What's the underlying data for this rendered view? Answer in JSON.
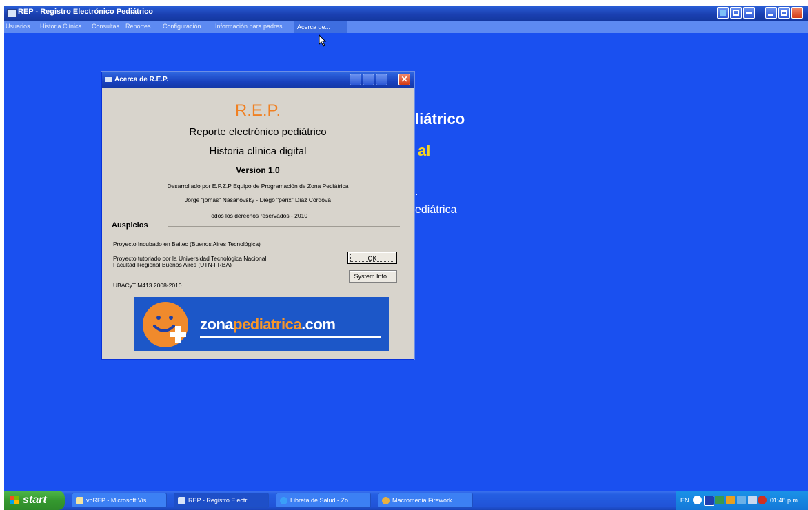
{
  "app": {
    "title": "REP - Registro Electrónico Pediátrico"
  },
  "menubar": {
    "items": [
      "Usuarios",
      "Historia Clínica",
      "Consultas",
      "Reportes",
      "Configuración",
      "Información para padres",
      "Acerca de..."
    ]
  },
  "background": {
    "line1": "liátrico",
    "line2": "al",
    "line3": ".",
    "line4": "ediátrica"
  },
  "dialog": {
    "title": "Acerca de R.E.P.",
    "app_name": "R.E.P.",
    "subtitle": "Reporte electrónico pediátrico",
    "subtitle2": "Historia clínica digital",
    "version": "Version 1.0",
    "dev": "Desarrollado por E.P.Z.P Equipo de Programación de Zona Pediátrica",
    "authors": "Jorge \"jomas\" Nasanovsky - Diego \"perix\" Díaz Córdova",
    "rights": "Todos los derechos reservados - 2010",
    "section_title": "Auspicios",
    "sponsor1": "Proyecto Incubado en Baitec (Buenos Aires Tecnológica)",
    "sponsor2_l1": "Proyecto tutoriado por la Universidad Tecnológica Nacional",
    "sponsor2_l2": "Facultad Regional Buenos Aires (UTN-FRBA)",
    "sponsor3": "UBACyT M413 2008-2010",
    "ok_label": "OK",
    "sysinfo_label": "System Info...",
    "banner": {
      "part1": "zona",
      "part2": "pediatrica",
      "part3": ".com"
    },
    "close_glyph": "✕"
  },
  "taskbar": {
    "start_label": "start",
    "tasks": [
      "vbREP - Microsoft Vis...",
      "REP - Registro Electr...",
      "Libreta de Salud - Zo...",
      "Macromedia Firework..."
    ],
    "lang": "EN",
    "clock": "01:48 p.m."
  },
  "colors": {
    "desktop": "#1a50f0",
    "accent_orange": "#f08022",
    "background_yellow": "#f7d324"
  }
}
